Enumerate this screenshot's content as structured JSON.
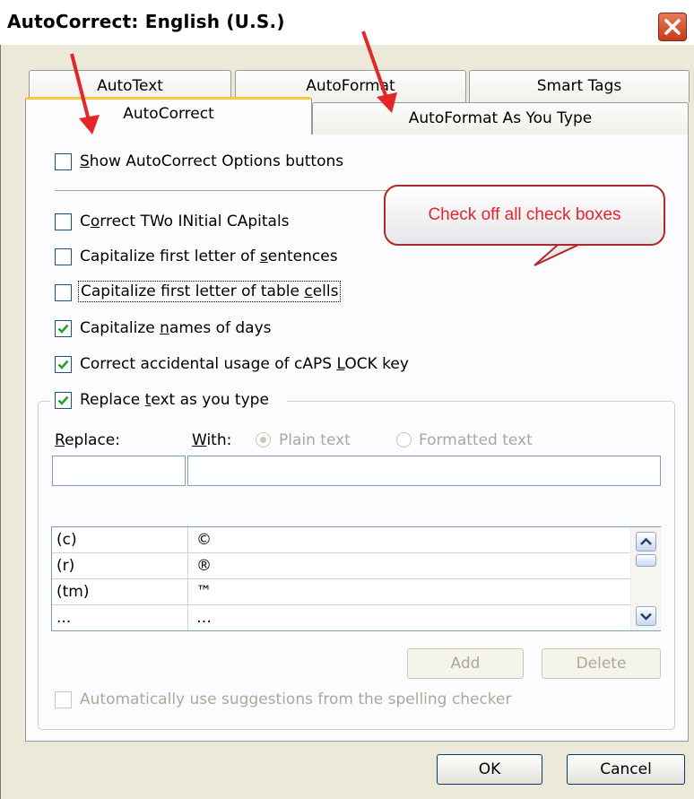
{
  "window": {
    "title": "AutoCorrect: English (U.S.)"
  },
  "tabs": {
    "autotext": "AutoText",
    "autoformat": "AutoFormat",
    "smart_tags": "Smart Tags",
    "autocorrect": "AutoCorrect",
    "autoformat_as_you_type": "AutoFormat As You Type"
  },
  "options": {
    "show_buttons": {
      "pre": "",
      "u": "S",
      "post": "how AutoCorrect Options buttons",
      "checked": false
    },
    "two_initial": {
      "pre": "C",
      "u": "o",
      "post": "rrect TWo INitial CApitals",
      "checked": false
    },
    "first_letter": {
      "pre": "Capitalize first letter of ",
      "u": "s",
      "post": "entences",
      "checked": false
    },
    "table_cells": {
      "pre": "Capitalize first letter of table ",
      "u": "c",
      "post": "ells",
      "checked": false
    },
    "days": {
      "pre": "Capitalize ",
      "u": "n",
      "post": "ames of days",
      "checked": true
    },
    "caps_lock": {
      "pre": "Correct accidental usage of cAPS ",
      "u": "L",
      "post": "OCK key",
      "checked": true
    },
    "replace": {
      "pre": "Replace ",
      "u": "t",
      "post": "ext as you type",
      "checked": true
    }
  },
  "replace_section": {
    "replace_label_u": "R",
    "replace_label_rest": "eplace:",
    "with_label_u": "W",
    "with_label_rest": "ith:",
    "plain_text": "Plain text",
    "formatted_text": "Formatted text",
    "replace_value": "",
    "with_value": ""
  },
  "entries": [
    {
      "replace": "(c)",
      "with": "©"
    },
    {
      "replace": "(r)",
      "with": "®"
    },
    {
      "replace": "(tm)",
      "with": "™"
    },
    {
      "replace": "...",
      "with": "…"
    }
  ],
  "buttons": {
    "add": "Add",
    "delete": "Delete",
    "ok": "OK",
    "cancel": "Cancel"
  },
  "spelling_option": "Automatically use suggestions from the spelling checker",
  "annotation": {
    "callout_text": "Check off all check boxes",
    "color": "#e2262a"
  }
}
